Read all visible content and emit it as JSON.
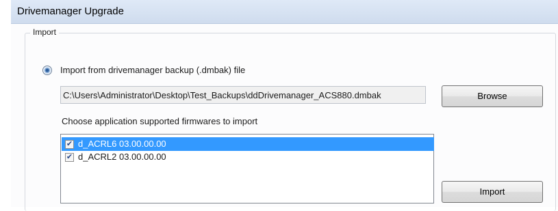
{
  "window": {
    "title": "Drivemanager Upgrade"
  },
  "import_group": {
    "legend": "Import",
    "radio_label": "Import from drivemanager backup (.dmbak) file",
    "radio_checked": true,
    "path_value": "C:\\Users\\Administrator\\Desktop\\Test_Backups\\ddDrivemanager_ACS880.dmbak",
    "browse_label": "Browse",
    "choose_label": "Choose application supported firmwares to import",
    "firmwares": [
      {
        "label": "d_ACRL6 03.00.00.00",
        "checked": true,
        "selected": true
      },
      {
        "label": "d_ACRL2 03.00.00.00",
        "checked": true,
        "selected": false
      }
    ],
    "import_label": "Import"
  },
  "colors": {
    "selection": "#3399ff",
    "titlebar": "#dfe9f7"
  }
}
